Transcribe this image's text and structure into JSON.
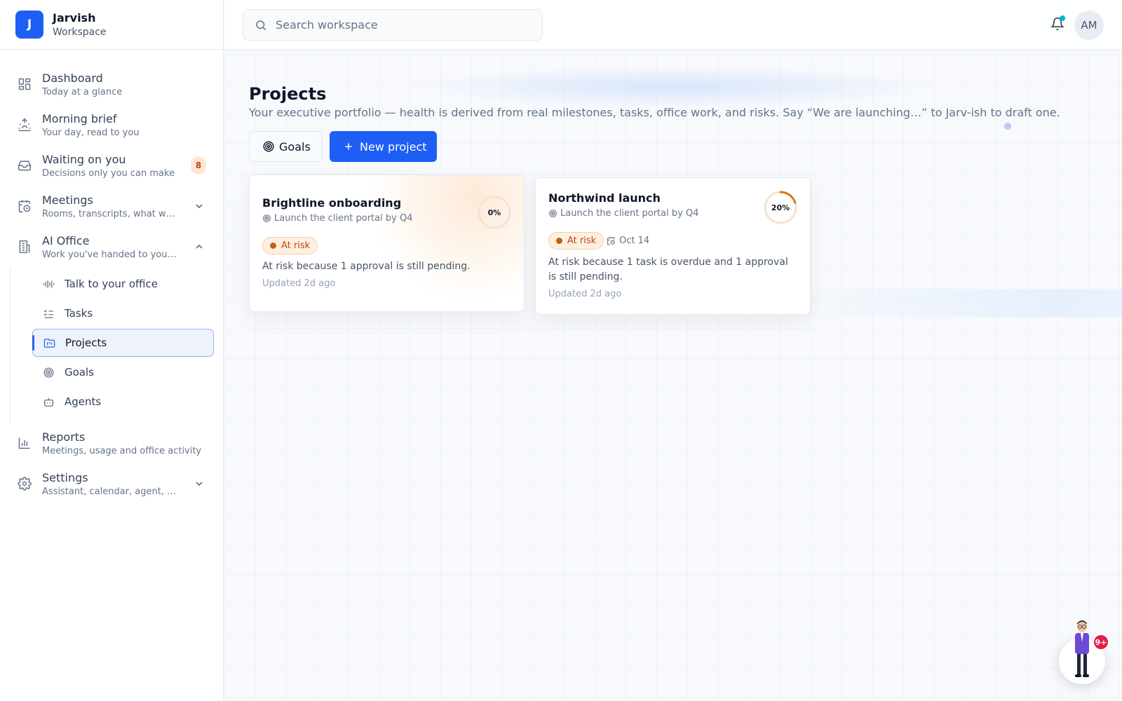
{
  "brand": {
    "initial": "J",
    "name": "Jarvish",
    "sub": "Workspace"
  },
  "nav": {
    "dashboard": {
      "label": "Dashboard",
      "sub": "Today at a glance"
    },
    "brief": {
      "label": "Morning brief",
      "sub": "Your day, read to you"
    },
    "waiting": {
      "label": "Waiting on you",
      "sub": "Decisions only you can make",
      "badge": "8"
    },
    "meetings": {
      "label": "Meetings",
      "sub": "Rooms, transcripts, what was..."
    },
    "office": {
      "label": "AI Office",
      "sub": "Work you've handed to your ..."
    },
    "sub": {
      "talk": "Talk to your office",
      "tasks": "Tasks",
      "projects": "Projects",
      "goals": "Goals",
      "agents": "Agents"
    },
    "reports": {
      "label": "Reports",
      "sub": "Meetings, usage and office activity"
    },
    "settings": {
      "label": "Settings",
      "sub": "Assistant, calendar, agent, bil..."
    }
  },
  "topbar": {
    "search_placeholder": "Search workspace",
    "avatar": "AM"
  },
  "page": {
    "title": "Projects",
    "description": "Your executive portfolio — health is derived from real milestones, tasks, office work, and risks. Say “We are launching…” to Jarv-ish to draft one.",
    "goals_button": "Goals",
    "new_button": "New project"
  },
  "projects": [
    {
      "title": "Brightline onboarding",
      "goal": "Launch the client portal by Q4",
      "progress": 0,
      "progress_label": "0%",
      "status": "At risk",
      "reason": "At risk because 1 approval is still pending.",
      "updated": "Updated 2d ago"
    },
    {
      "title": "Northwind launch",
      "goal": "Launch the client portal by Q4",
      "progress": 20,
      "progress_label": "20%",
      "status": "At risk",
      "due": "Oct 14",
      "reason": "At risk because 1 task is overdue and 1 approval is still pending.",
      "updated": "Updated 2d ago"
    }
  ],
  "assistant": {
    "badge": "9+"
  },
  "colors": {
    "accent": "#1d5ff5",
    "risk": "#c2410c",
    "ring_track": "#f5e3d0",
    "ring_fill": "#d97706"
  }
}
